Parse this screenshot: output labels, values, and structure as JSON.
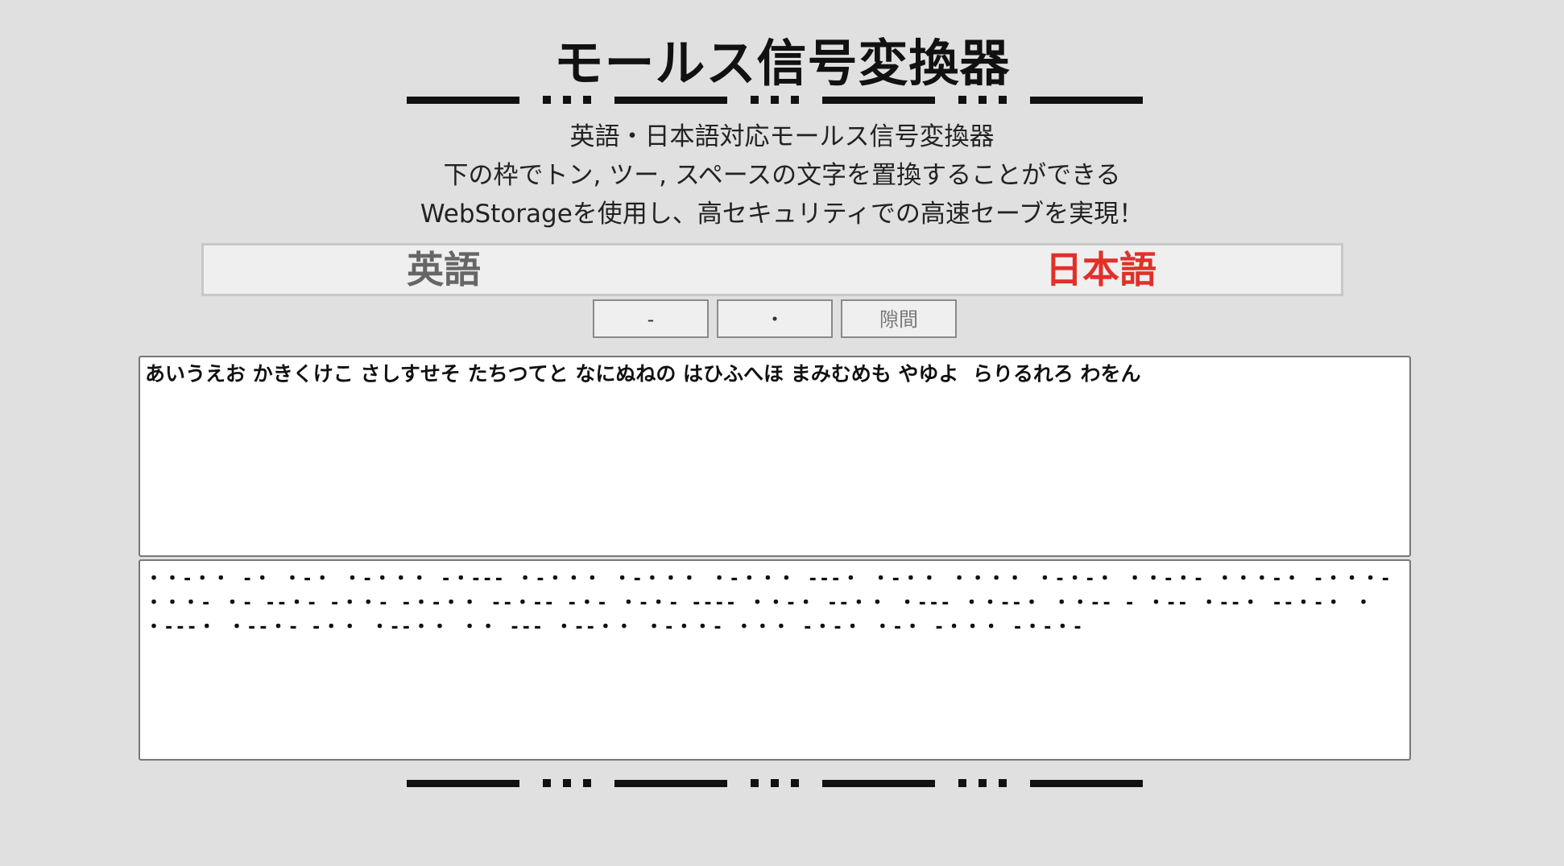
{
  "header": {
    "title": "モールス信号変換器"
  },
  "description": {
    "line1": "英語・日本語対応モールス信号変換器",
    "line2": "下の枠でトン, ツー, スペースの文字を置換することができる",
    "line3": "WebStorageを使用し、高セキュリティでの高速セーブを実現！"
  },
  "language_tabs": {
    "english": "英語",
    "japanese": "日本語",
    "active": "japanese",
    "active_color": "#e0302a",
    "inactive_color": "#666666"
  },
  "symbol_buttons": {
    "dash": "-",
    "dot": "・",
    "gap": "隙間"
  },
  "input_text": "あいうえお かきくけこ さしすせそ たちつてと なにぬねの はひふへほ まみむめも やゆよ  らりるれろ わをん",
  "output_text": "・・-・・ -・ ・-・ ・-・・・ -・--- ・-・・・ ・-・・・ ・-・・・ ---・ ・-・・ ・・・・ ・-・-・ ・・-・- ・・・-・ -・・・- ・・・- ・- --・- -・・- -・-・・ --・-- -・- ・-・- ---- ・・-・ --・・ ・--- ・・--・ ・・-- - ・-- ・--・ --・-・ ・ ・---・ ・--・- -・・ ・--・・ ・・ --- ・--・・ ・-・・- ・・・ -・-・ ・-・ -・・・ -・-・-"
}
